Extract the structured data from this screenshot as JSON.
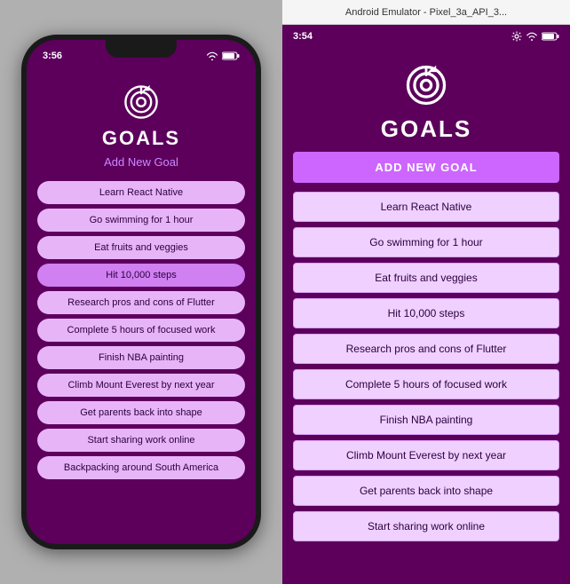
{
  "ios": {
    "statusTime": "3:56",
    "title": "GOALS",
    "addLabel": "Add New Goal",
    "goals": [
      {
        "label": "Learn React Native",
        "highlighted": false
      },
      {
        "label": "Go swimming for 1 hour",
        "highlighted": false
      },
      {
        "label": "Eat fruits and veggies",
        "highlighted": false
      },
      {
        "label": "Hit 10,000 steps",
        "highlighted": true
      },
      {
        "label": "Research pros and cons of Flutter",
        "highlighted": false
      },
      {
        "label": "Complete 5 hours of focused work",
        "highlighted": false
      },
      {
        "label": "Finish NBA painting",
        "highlighted": false
      },
      {
        "label": "Climb Mount Everest by next year",
        "highlighted": false
      },
      {
        "label": "Get parents back into shape",
        "highlighted": false
      },
      {
        "label": "Start sharing work online",
        "highlighted": false
      },
      {
        "label": "Backpacking around South America",
        "highlighted": false
      }
    ]
  },
  "android": {
    "titlebarLabel": "Android Emulator - Pixel_3a_API_3...",
    "statusTime": "3:54",
    "title": "GOALS",
    "addNewLabel": "ADD NEW GOAL",
    "goals": [
      "Learn React Native",
      "Go swimming for 1 hour",
      "Eat fruits and veggies",
      "Hit 10,000 steps",
      "Research pros and cons of Flutter",
      "Complete 5 hours of focused work",
      "Finish NBA painting",
      "Climb Mount Everest by next year",
      "Get parents back into shape",
      "Start sharing work online"
    ]
  }
}
